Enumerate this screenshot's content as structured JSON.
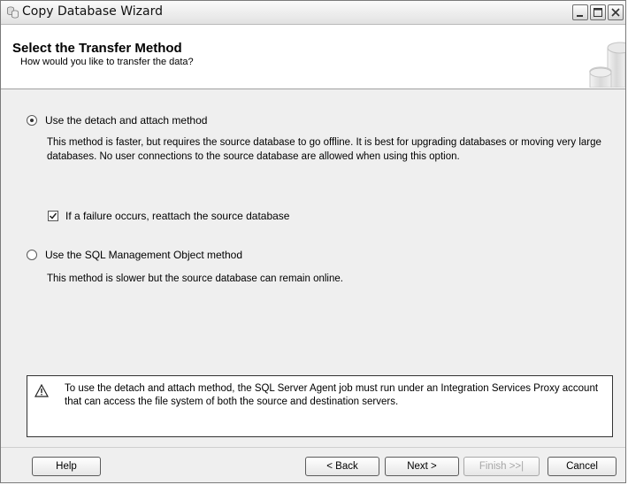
{
  "window": {
    "title": "Copy Database Wizard"
  },
  "header": {
    "title": "Select the Transfer Method",
    "subtitle": "How would you like to transfer the data?"
  },
  "options": {
    "detach": {
      "label": "Use the detach and attach method",
      "selected": true,
      "description": "This method is faster, but requires the source database to go offline. It is best for upgrading databases or moving very large databases. No user connections to the source database are allowed when using this option."
    },
    "reattach": {
      "label": "If a failure occurs, reattach the source database",
      "checked": true
    },
    "smo": {
      "label": "Use the SQL Management Object method",
      "selected": false,
      "description": "This method is slower but the source database can remain online."
    }
  },
  "notice": {
    "icon": "warning-icon",
    "text": "To use the detach and attach method, the SQL Server Agent job must run under an Integration Services Proxy account that can access the file system of both the source and destination servers."
  },
  "buttons": {
    "help": "Help",
    "back": "< Back",
    "next": "Next >",
    "finish": "Finish >>|",
    "cancel": "Cancel"
  }
}
